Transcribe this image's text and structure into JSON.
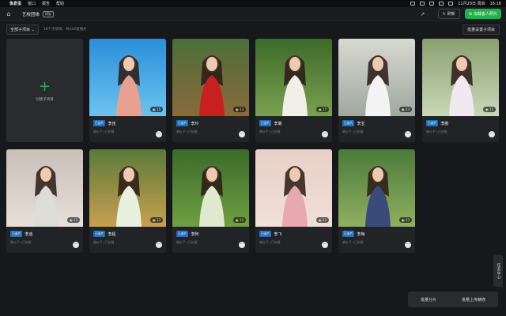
{
  "menubar": {
    "app": "像素蛋",
    "items": [
      "窗口",
      "报告",
      "帮助"
    ],
    "datetime": "11月29日 周四",
    "time": "16:18"
  },
  "toolbar": {
    "title": "艺校团体",
    "badge": "模板",
    "refresh_label": "刷新",
    "add_label": "加载客人照片"
  },
  "filter": {
    "dropdown_label": "全部子项目",
    "count_text": "18个子项目，共142张照片",
    "batch_set_label": "批量设置子项目"
  },
  "add_card": {
    "label": "创建子项目"
  },
  "colors": {
    "accent_green": "#21b04b",
    "tag_blue": "#1e6fb8"
  },
  "cards": [
    {
      "tag": "已选片",
      "name": "李佳",
      "count": "15",
      "sub": "婚纱子·1已拍摄"
    },
    {
      "tag": "已选片",
      "name": "李玲",
      "count": "13",
      "sub": "婚纱子·1已拍摄"
    },
    {
      "tag": "已选片",
      "name": "李璐",
      "count": "17",
      "sub": "婚纱子·1已拍摄"
    },
    {
      "tag": "已选片",
      "name": "李宝",
      "count": "13",
      "sub": "婚纱子·1已拍摄"
    },
    {
      "tag": "已选片",
      "name": "李鹏",
      "count": "11",
      "sub": "婚纱子·1已拍摄"
    },
    {
      "tag": "已选片",
      "name": "李迪",
      "count": "13",
      "sub": "婚纱子·1已拍摄"
    },
    {
      "tag": "已选片",
      "name": "李超",
      "count": "13",
      "sub": "婚纱子·1已拍摄"
    },
    {
      "tag": "已选片",
      "name": "李阿",
      "count": "14",
      "sub": "婚纱子·1已拍摄"
    },
    {
      "tag": "已选片",
      "name": "李飞",
      "count": "22",
      "sub": "婚纱子·1已拍摄"
    },
    {
      "tag": "已选片",
      "name": "李梅",
      "count": "13",
      "sub": "婚纱子·1已拍摄"
    }
  ],
  "side_tab": {
    "label": "任务中心"
  },
  "bottom": {
    "split_label": "批量分片",
    "upload_label": "批量上传精修"
  }
}
